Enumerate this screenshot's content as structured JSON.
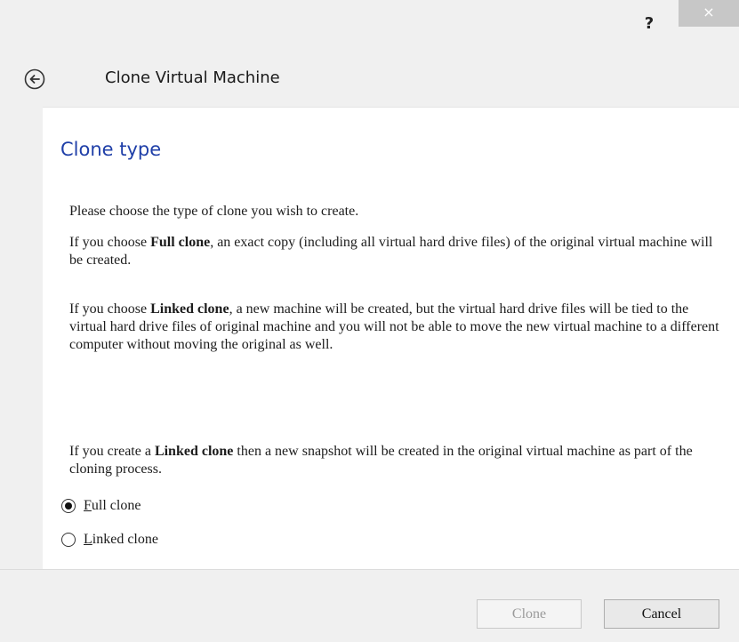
{
  "window": {
    "help_label": "?",
    "close_label": "×"
  },
  "header": {
    "title": "Clone Virtual Machine"
  },
  "page": {
    "section_title": "Clone type",
    "intro": "Please choose the type of clone you wish to create.",
    "full_para": {
      "pre": "If you choose ",
      "bold": "Full clone",
      "post": ", an exact copy (including all virtual hard drive files) of the original virtual machine will be created."
    },
    "linked_para": {
      "pre": "If you choose ",
      "bold": "Linked clone",
      "post": ", a new machine will be created, but the virtual hard drive files will be tied to the virtual hard drive files of original machine and you will not be able to move the new virtual machine to a different computer without moving the original as well."
    },
    "snapshot_para": {
      "pre": "If you create a ",
      "bold": "Linked clone",
      "post": " then a new snapshot will be created in the original virtual machine as part of the cloning process."
    }
  },
  "options": {
    "full": {
      "accel": "F",
      "rest": "ull clone",
      "checked": true
    },
    "linked": {
      "accel": "L",
      "rest": "inked clone",
      "checked": false
    }
  },
  "buttons": {
    "clone_label": "Clone",
    "clone_enabled": false,
    "cancel_label": "Cancel"
  },
  "colors": {
    "accent": "#1f3fa8",
    "close_button_bg": "#c7c7c7"
  }
}
